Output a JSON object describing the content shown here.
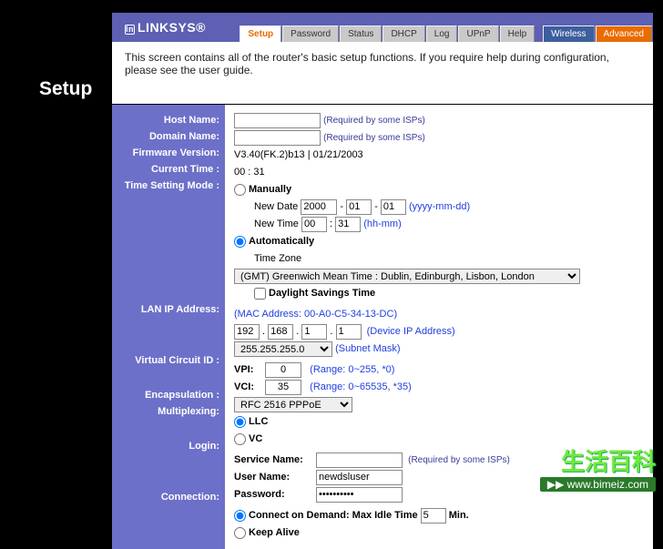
{
  "brand": "LINKSYS®",
  "tabs": {
    "list": [
      "Setup",
      "Password",
      "Status",
      "DHCP",
      "Log",
      "UPnP",
      "Help"
    ],
    "active": 0,
    "wireless": "Wireless",
    "advanced": "Advanced"
  },
  "help_text": "This screen contains all of the router's basic setup functions. If you require help during configuration, please see the user guide.",
  "page_title": "Setup",
  "labels": {
    "host": "Host Name:",
    "domain": "Domain Name:",
    "fw": "Firmware Version:",
    "time": "Current Time :",
    "mode": "Time Setting Mode :",
    "lan": "LAN IP Address:",
    "vc": "Virtual Circuit ID :",
    "encap": "Encapsulation :",
    "mux": "Multiplexing:",
    "login": "Login:",
    "conn": "Connection:"
  },
  "form": {
    "host_value": "",
    "host_hint": "(Required by some ISPs)",
    "domain_value": "",
    "domain_hint": "(Required by some ISPs)",
    "fw_value": "V3.40(FK.2)b13 | 01/21/2003",
    "current_time": "00 : 31",
    "manual_label": "Manually",
    "newdate_label": "New Date",
    "date_y": "2000",
    "date_m": "01",
    "date_d": "01",
    "date_hint": "(yyyy-mm-dd)",
    "newtime_label": "New Time",
    "time_h": "00",
    "time_m": "31",
    "time_hint": "(hh-mm)",
    "auto_label": "Automatically",
    "tz_label": "Time Zone",
    "tz_value": "(GMT) Greenwich Mean Time : Dublin, Edinburgh, Lisbon, London",
    "dst_label": "Daylight Savings Time",
    "mac_hint": "(MAC Address: 00-A0-C5-34-13-DC)",
    "ip": [
      "192",
      "168",
      "1",
      "1"
    ],
    "ip_hint": "(Device IP Address)",
    "subnet": "255.255.255.0",
    "subnet_hint": "(Subnet Mask)",
    "vpi_label": "VPI:",
    "vpi_value": "0",
    "vpi_hint": "(Range: 0~255, *0)",
    "vci_label": "VCI:",
    "vci_value": "35",
    "vci_hint": "(Range: 0~65535, *35)",
    "encap_value": "RFC 2516 PPPoE",
    "mux_llc": "LLC",
    "mux_vc": "VC",
    "service_label": "Service Name:",
    "service_value": "",
    "service_hint": "(Required by some ISPs)",
    "user_label": "User Name:",
    "user_value": "newdsluser",
    "pass_label": "Password:",
    "pass_value": "••••••••••",
    "cod_label_a": "Connect on Demand: Max Idle Time",
    "cod_value": "5",
    "cod_label_b": "Min.",
    "keepalive_label": "Keep Alive"
  },
  "watermark": {
    "line1": "生活百科",
    "line2": "www.bimeiz.com"
  }
}
